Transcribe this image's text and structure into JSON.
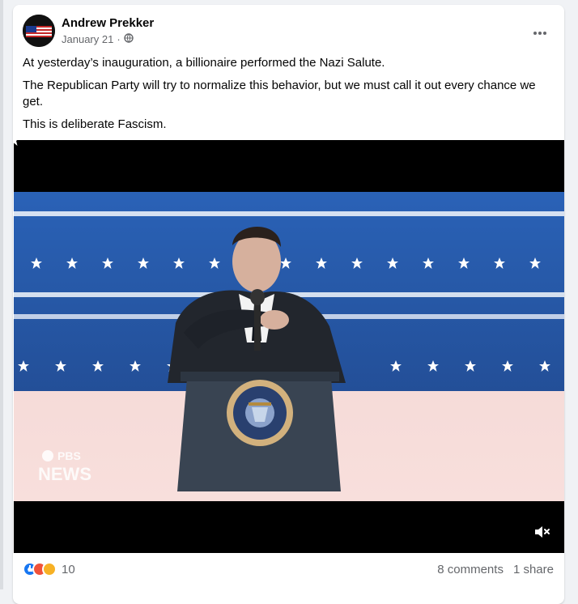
{
  "post": {
    "author": "Andrew Prekker",
    "date": "January 21",
    "separator": "·",
    "privacy_icon": "globe-icon",
    "more_icon": "more-dots-icon",
    "paragraphs": [
      "At yesterday’s inauguration, a billionaire performed the Nazi Salute.",
      "The Republican Party will try to normalize this behavior, but we must call it out every chance we get.",
      "This is deliberate Fascism."
    ],
    "video": {
      "watermark_top": "PBS",
      "watermark_bottom": "NEWS",
      "seal_text": "PRESIDENT OF THE UNITED STATES · SEAL OF THE ·",
      "mute_icon": "muted-speaker-icon"
    },
    "footer": {
      "reaction_count": "10",
      "comments": "8 comments",
      "shares": "1 share",
      "reaction_icons": [
        "like-icon",
        "angry-icon",
        "sad-icon"
      ]
    }
  },
  "colors": {
    "like": "#1877f2",
    "angry": "#f0523a",
    "sad": "#f7b125",
    "text": "#050505",
    "meta": "#65676b"
  }
}
